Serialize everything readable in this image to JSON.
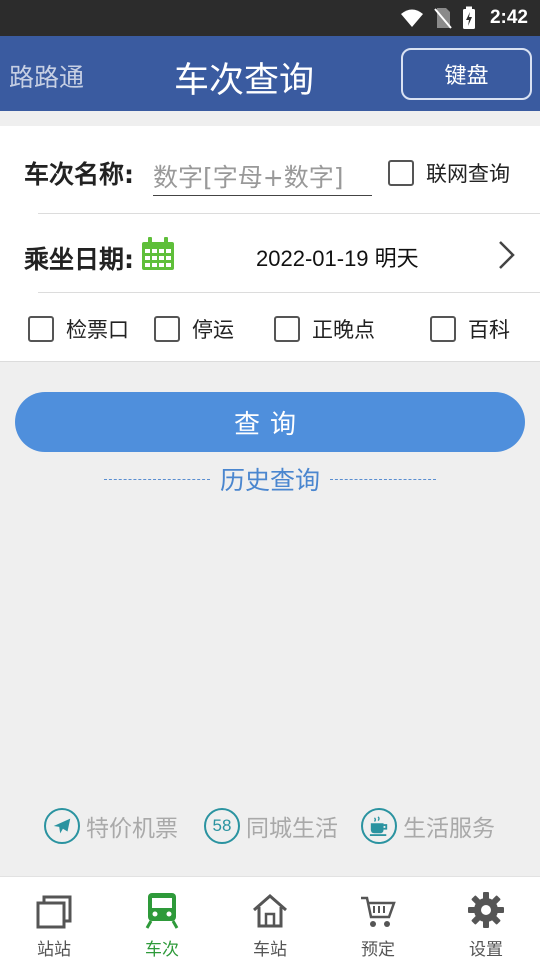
{
  "status_bar": {
    "time": "2:42"
  },
  "header": {
    "brand": "路路通",
    "title": "车次查询",
    "keyboard_button": "键盘"
  },
  "form": {
    "train_label": "车次名称:",
    "train_placeholder": "数字[字母+数字]",
    "online_query_label": "联网查询",
    "date_label": "乘坐日期:",
    "date_value": "2022-01-19 明天",
    "options": [
      {
        "label": "检票口",
        "checked": false
      },
      {
        "label": "停运",
        "checked": false
      },
      {
        "label": "正晚点",
        "checked": false
      },
      {
        "label": "百科",
        "checked": false
      }
    ]
  },
  "query_button": "查询",
  "history_link": "历史查询",
  "services": [
    {
      "icon": "airplane-icon",
      "label": "特价机票"
    },
    {
      "icon": "58-icon",
      "badge": "58",
      "label": "同城生活"
    },
    {
      "icon": "coffee-cup-icon",
      "label": "生活服务"
    }
  ],
  "bottom_nav": [
    {
      "icon": "station-icon",
      "label": "站站",
      "active": false
    },
    {
      "icon": "train-icon",
      "label": "车次",
      "active": true
    },
    {
      "icon": "home-station-icon",
      "label": "车站",
      "active": false
    },
    {
      "icon": "cart-icon",
      "label": "预定",
      "active": false
    },
    {
      "icon": "gear-icon",
      "label": "设置",
      "active": false
    }
  ],
  "colors": {
    "header_bg": "#3a5ba0",
    "button_blue": "#4f8fdc",
    "active_green": "#2e9a3a",
    "service_teal": "#2a93a0"
  }
}
